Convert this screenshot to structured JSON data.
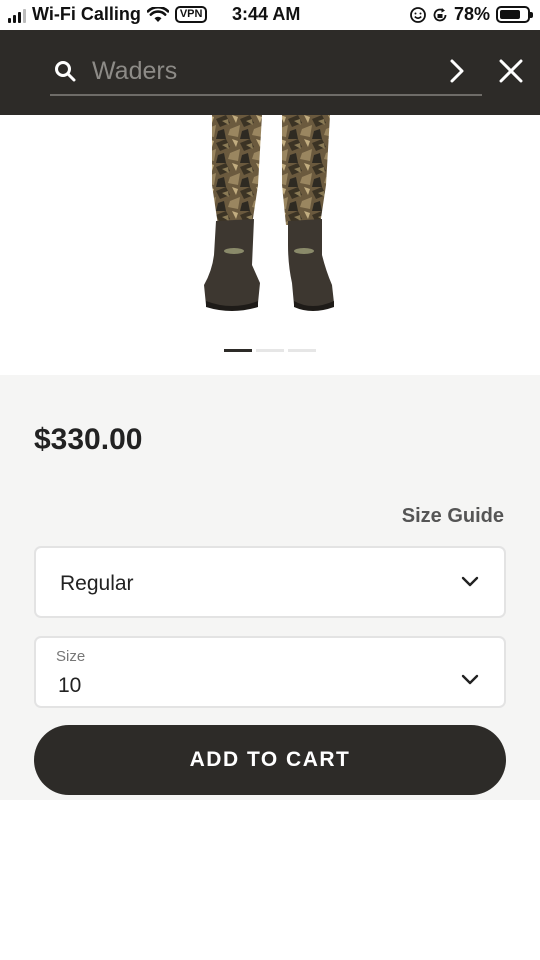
{
  "status_bar": {
    "carrier": "Wi-Fi Calling",
    "vpn": "VPN",
    "time": "3:44 AM",
    "battery": "78%",
    "battery_level": 0.78
  },
  "search": {
    "placeholder": "Waders",
    "value": ""
  },
  "icons": {
    "search": "search-icon",
    "submit": "chevron-right-icon",
    "close": "close-icon",
    "dropdown": "chevron-down-icon"
  },
  "carousel": {
    "slides": 3,
    "active_index": 0
  },
  "product": {
    "price": "$330.00",
    "size_guide_label": "Size Guide",
    "fit": {
      "value": "Regular"
    },
    "size": {
      "label": "Size",
      "value": "10"
    },
    "add_to_cart_label": "ADD TO CART"
  },
  "colors": {
    "header_bg": "#2d2b28",
    "button_bg": "#2d2b28",
    "panel_bg": "#f5f5f4"
  }
}
